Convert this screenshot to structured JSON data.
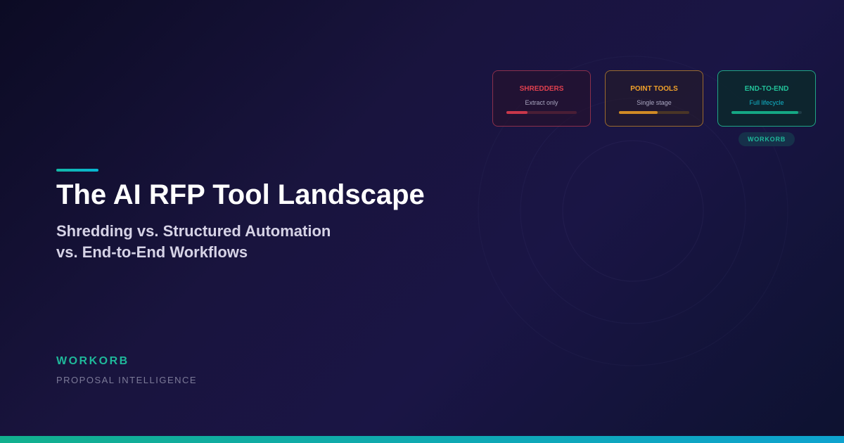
{
  "hero": {
    "title": "The AI RFP Tool Landscape",
    "subtitle_line1": "Shredding vs. Structured Automation",
    "subtitle_line2": "vs. End-to-End Workflows"
  },
  "brand": {
    "name": "WORKORB",
    "tagline": "PROPOSAL INTELLIGENCE"
  },
  "cards": [
    {
      "title": "SHREDDERS",
      "subtitle": "Extract only",
      "level": 0.3,
      "accent": "#e0404f"
    },
    {
      "title": "POINT TOOLS",
      "subtitle": "Single stage",
      "level": 0.55,
      "accent": "#f0a12a"
    },
    {
      "title": "END-TO-END",
      "subtitle": "Full lifecycle",
      "level": 0.95,
      "accent": "#22c39a"
    }
  ],
  "badge": {
    "label": "WORKORB"
  },
  "colors": {
    "brand_teal": "#1fb89a",
    "accent_cyan": "#06b6d4",
    "background": "#19143e"
  }
}
